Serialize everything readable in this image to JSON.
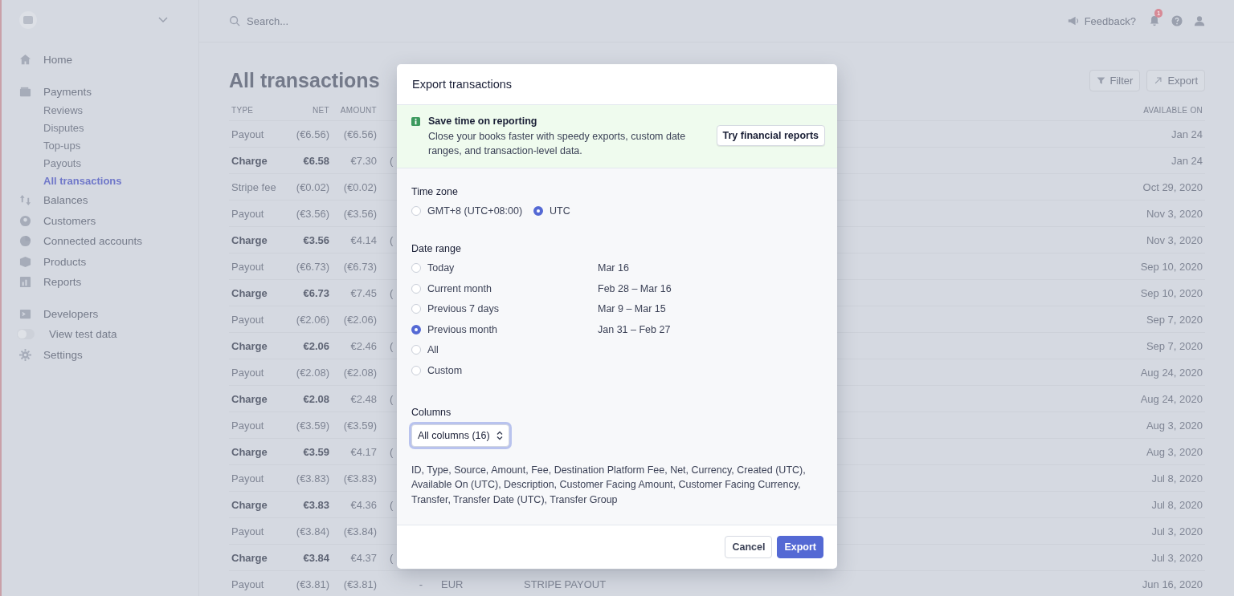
{
  "sidebar": {
    "groups": [
      [
        {
          "label": "Home",
          "selected": false
        }
      ],
      [
        {
          "label": "Payments",
          "selected": false,
          "children": [
            {
              "label": "Reviews",
              "selected": false
            },
            {
              "label": "Disputes",
              "selected": false
            },
            {
              "label": "Top-ups",
              "selected": false
            },
            {
              "label": "Payouts",
              "selected": false
            },
            {
              "label": "All transactions",
              "selected": true
            }
          ]
        },
        {
          "label": "Balances",
          "selected": false
        },
        {
          "label": "Customers",
          "selected": false
        },
        {
          "label": "Connected accounts",
          "selected": false
        },
        {
          "label": "Products",
          "selected": false
        },
        {
          "label": "Reports",
          "selected": false
        }
      ],
      [
        {
          "label": "Developers",
          "selected": false
        },
        {
          "label": "View test data",
          "kind": "toggle",
          "on": false,
          "selected": false
        },
        {
          "label": "Settings",
          "selected": false
        }
      ]
    ]
  },
  "topbar": {
    "search": {
      "placeholder": "Search..."
    },
    "feedback": "Feedback?",
    "notifications": "1"
  },
  "page": {
    "title": "All transactions",
    "actions": [
      {
        "label": "Filter"
      },
      {
        "label": "Export"
      }
    ]
  },
  "table": {
    "columns": {
      "type": "TYPE",
      "net": "NET",
      "amount": "AMOUNT",
      "available_on": "AVAILABLE ON"
    },
    "rows": [
      {
        "kind": "payout",
        "type": "Payout",
        "net": "(€6.56)",
        "amount": "(€6.56)",
        "available_on": "Jan 24"
      },
      {
        "kind": "charge",
        "type": "Charge",
        "net": "€6.58",
        "amount": "€7.30",
        "column_4": "(",
        "available_on": "Jan 24"
      },
      {
        "kind": "fee",
        "type": "Stripe fee",
        "net": "(€0.02)",
        "amount": "(€0.02)",
        "available_on": "Oct 29, 2020"
      },
      {
        "kind": "payout",
        "type": "Payout",
        "net": "(€3.56)",
        "amount": "(€3.56)",
        "available_on": "Nov 3, 2020"
      },
      {
        "kind": "charge",
        "type": "Charge",
        "net": "€3.56",
        "amount": "€4.14",
        "column_4": "(",
        "available_on": "Nov 3, 2020"
      },
      {
        "kind": "payout",
        "type": "Payout",
        "net": "(€6.73)",
        "amount": "(€6.73)",
        "available_on": "Sep 10, 2020"
      },
      {
        "kind": "charge",
        "type": "Charge",
        "net": "€6.73",
        "amount": "€7.45",
        "column_4": "(",
        "available_on": "Sep 10, 2020"
      },
      {
        "kind": "payout",
        "type": "Payout",
        "net": "(€2.06)",
        "amount": "(€2.06)",
        "available_on": "Sep 7, 2020"
      },
      {
        "kind": "charge",
        "type": "Charge",
        "net": "€2.06",
        "amount": "€2.46",
        "column_4": "(",
        "available_on": "Sep 7, 2020"
      },
      {
        "kind": "payout",
        "type": "Payout",
        "net": "(€2.08)",
        "amount": "(€2.08)",
        "available_on": "Aug 24, 2020"
      },
      {
        "kind": "charge",
        "type": "Charge",
        "net": "€2.08",
        "amount": "€2.48",
        "column_4": "(",
        "available_on": "Aug 24, 2020"
      },
      {
        "kind": "payout",
        "type": "Payout",
        "net": "(€3.59)",
        "amount": "(€3.59)",
        "available_on": "Aug 3, 2020"
      },
      {
        "kind": "charge",
        "type": "Charge",
        "net": "€3.59",
        "amount": "€4.17",
        "column_4": "(",
        "available_on": "Aug 3, 2020"
      },
      {
        "kind": "payout",
        "type": "Payout",
        "net": "(€3.83)",
        "amount": "(€3.83)",
        "available_on": "Jul 8, 2020"
      },
      {
        "kind": "charge",
        "type": "Charge",
        "net": "€3.83",
        "amount": "€4.36",
        "column_4": "(",
        "available_on": "Jul 8, 2020"
      },
      {
        "kind": "payout",
        "type": "Payout",
        "net": "(€3.84)",
        "amount": "(€3.84)",
        "available_on": "Jul 3, 2020"
      },
      {
        "kind": "charge",
        "type": "Charge",
        "net": "€3.84",
        "amount": "€4.37",
        "column_4": "(",
        "available_on": "Jul 3, 2020"
      },
      {
        "kind": "payout",
        "type": "Payout",
        "net": "(€3.81)",
        "amount": "(€3.81)",
        "column_5": "-",
        "column_6": "EUR",
        "column_7": "STRIPE PAYOUT",
        "available_on": "Jun 16, 2020"
      }
    ]
  },
  "modal": {
    "title": "Export transactions",
    "banner": {
      "title": "Save time on reporting",
      "text": "Close your books faster with speedy exports, custom date ranges, and transaction-level data.",
      "button": "Try financial reports"
    },
    "time_zone": {
      "label": "Time zone",
      "options": [
        {
          "label": "GMT+8 (UTC+08:00)",
          "selected": false
        },
        {
          "label": "UTC",
          "selected": true
        }
      ]
    },
    "date_range": {
      "label": "Date range",
      "options": [
        {
          "label": "Today",
          "range": "Mar 16",
          "selected": false
        },
        {
          "label": "Current month",
          "range": "Feb 28 – Mar 16",
          "selected": false
        },
        {
          "label": "Previous 7 days",
          "range": "Mar 9 – Mar 15",
          "selected": false
        },
        {
          "label": "Previous month",
          "range": "Jan 31 – Feb 27",
          "selected": true
        },
        {
          "label": "All",
          "selected": false
        },
        {
          "label": "Custom",
          "selected": false
        }
      ]
    },
    "columns": {
      "label": "Columns",
      "select": "All columns (16)",
      "description": "ID, Type, Source, Amount, Fee, Destination Platform Fee, Net, Currency, Created (UTC), Available On (UTC), Description, Customer Facing Amount, Customer Facing Currency, Transfer, Transfer Date (UTC), Transfer Group"
    },
    "buttons": [
      {
        "label": "Cancel",
        "kind": "secondary"
      },
      {
        "label": "Export",
        "kind": "primary"
      }
    ]
  }
}
